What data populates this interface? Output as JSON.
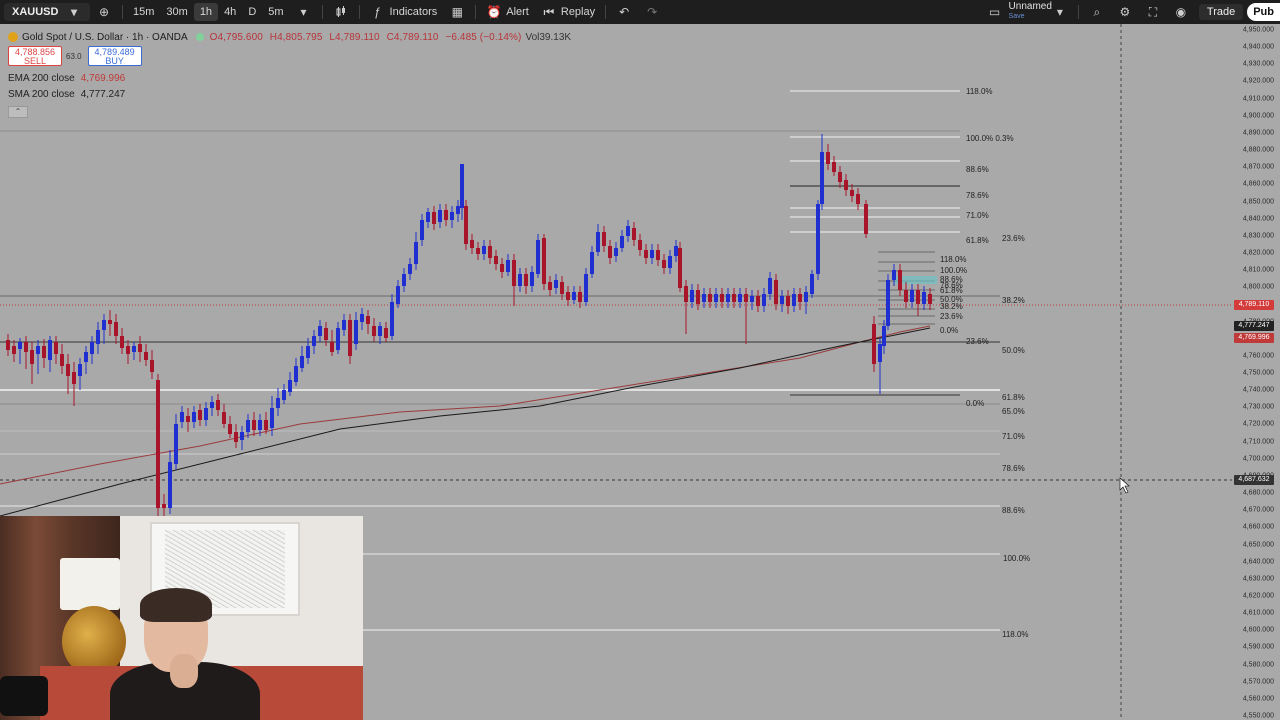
{
  "toolbar": {
    "symbol": "XAUUSD",
    "intervals": [
      "15m",
      "30m",
      "1h",
      "4h",
      "D",
      "5m"
    ],
    "active_interval": "1h",
    "indicators_label": "Indicators",
    "alert_label": "Alert",
    "replay_label": "Replay",
    "layout_name": "Unnamed",
    "layout_status": "Save",
    "trade_label": "Trade",
    "publish_label": "Pub"
  },
  "legend": {
    "title": "Gold Spot / U.S. Dollar · 1h · OANDA",
    "open": "O4,795.600",
    "high": "H4,805.795",
    "low": "L4,789.110",
    "close": "C4,789.110",
    "change": "−6.485 (−0.14%)",
    "volume": "Vol39.13K",
    "sell_price": "4,788.856",
    "sell_label": "SELL",
    "spread": "63.0",
    "buy_price": "4,789.489",
    "buy_label": "BUY",
    "ema_label": "EMA 200 close",
    "ema_value": "4,769.996",
    "sma_label": "SMA 200 close",
    "sma_value": "4,777.247"
  },
  "price_scale": {
    "labels": [
      "4,950.000",
      "4,940.000",
      "4,930.000",
      "4,920.000",
      "4,910.000",
      "4,900.000",
      "4,890.000",
      "4,880.000",
      "4,870.000",
      "4,860.000",
      "4,850.000",
      "4,840.000",
      "4,830.000",
      "4,820.000",
      "4,810.000",
      "4,800.000",
      "4,790.000",
      "4,780.000",
      "4,770.000",
      "4,760.000",
      "4,750.000",
      "4,740.000",
      "4,730.000",
      "4,720.000",
      "4,710.000",
      "4,700.000",
      "4,690.000",
      "4,680.000",
      "4,670.000",
      "4,660.000",
      "4,650.000",
      "4,640.000",
      "4,630.000",
      "4,620.000",
      "4,610.000",
      "4,600.000",
      "4,590.000",
      "4,580.000",
      "4,570.000",
      "4,560.000",
      "4,550.000"
    ],
    "last_price_tag": "4,789.110",
    "sma_tag": "4,777.247",
    "ema_tag": "4,769.996",
    "crosshair_tag": "4,687.632",
    "colors": {
      "last": "#d43c3c",
      "sma": "#222222",
      "ema": "#c03a3a",
      "crosshair": "#333333"
    }
  },
  "chart": {
    "fib_large_right": [
      "61.8%",
      "65.0%",
      "71.0%",
      "78.6%",
      "88.6%",
      "100.0%",
      "118.0%"
    ],
    "fib_large_left": [
      "23.6%",
      "38.2%",
      "50.0%"
    ],
    "fib_upper": [
      "118.0%",
      "100.0% 0.3%",
      "88.6%",
      "78.6%",
      "71.0%",
      "61.8%",
      "23.6%",
      "0.0%"
    ],
    "fib_small": [
      "118.0%",
      "100.0%",
      "88.6%",
      "78.6%",
      "61.8%",
      "50.0%",
      "38.2%",
      "23.6%",
      "0.0%"
    ],
    "colors": {
      "up": "#1f2fd0",
      "down": "#a8152a",
      "ema": "#9a3b3b",
      "sma": "#1a1a1a"
    }
  }
}
